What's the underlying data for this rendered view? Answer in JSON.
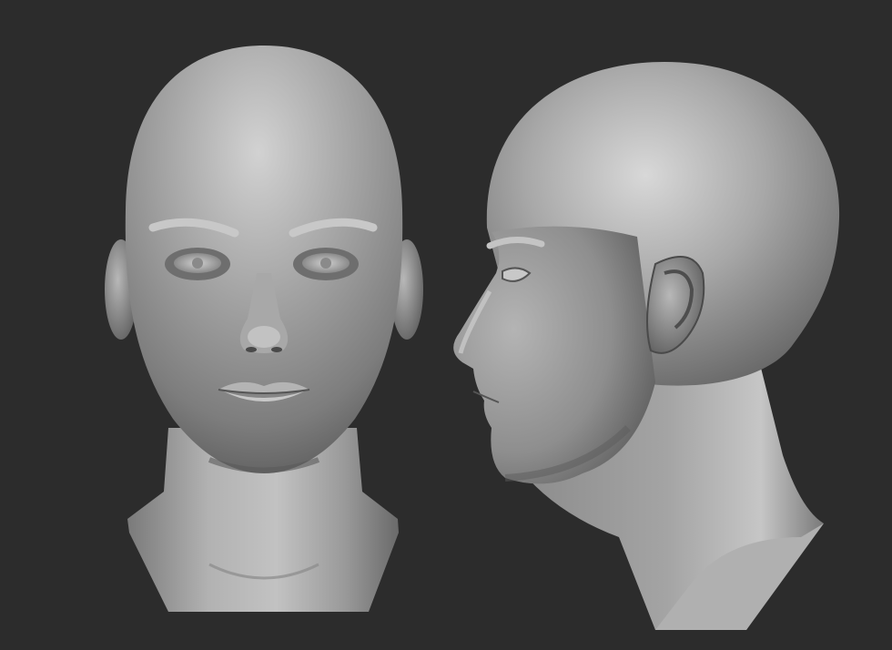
{
  "scene": {
    "background_color": "#2c2c2c",
    "clay_color": "#9a9a9a",
    "clay_highlight": "#d6d6d6",
    "clay_shadow": "#3c3c3c",
    "views": [
      {
        "name": "front-view"
      },
      {
        "name": "side-view"
      }
    ]
  }
}
